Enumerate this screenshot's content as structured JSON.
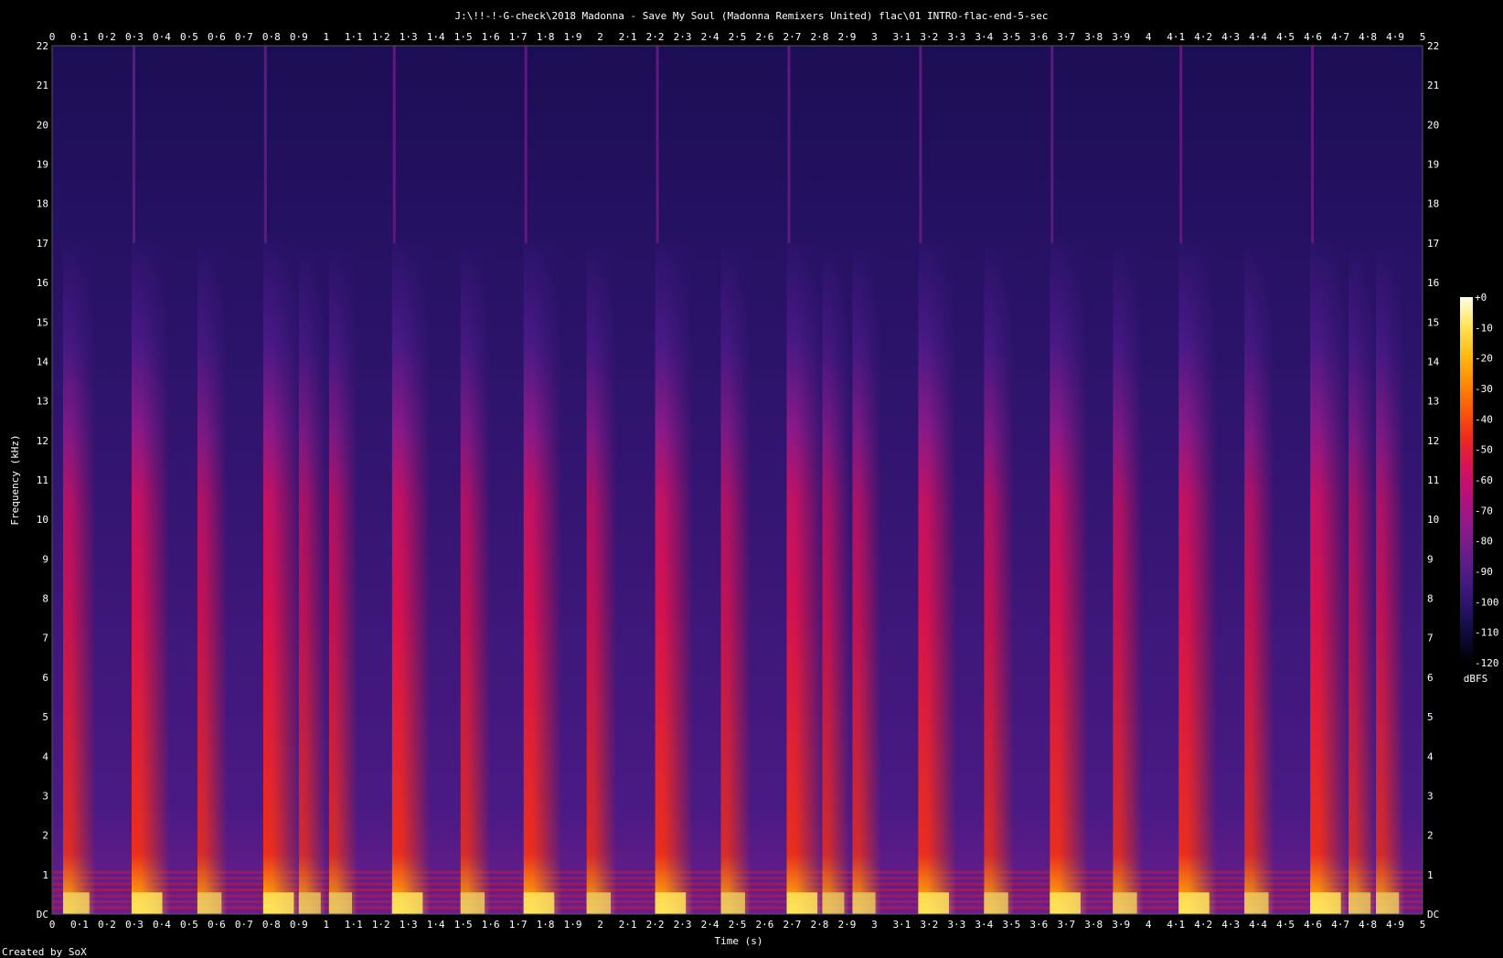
{
  "footer": {
    "credit": "Created by SoX"
  },
  "chart_data": {
    "type": "heatmap",
    "title": "J:\\!!-!-G-check\\2018 Madonna - Save My Soul (Madonna Remixers United) flac\\01 INTRO-flac-end-5-sec",
    "xlabel": "Time (s)",
    "ylabel": "Frequency (kHz)",
    "xlim": [
      0,
      5
    ],
    "ylim": [
      0,
      22
    ],
    "x_ticks": [
      "0",
      "0·1",
      "0·2",
      "0·3",
      "0·4",
      "0·5",
      "0·6",
      "0·7",
      "0·8",
      "0·9",
      "1",
      "1·1",
      "1·2",
      "1·3",
      "1·4",
      "1·5",
      "1·6",
      "1·7",
      "1·8",
      "1·9",
      "2",
      "2·1",
      "2·2",
      "2·3",
      "2·4",
      "2·5",
      "2·6",
      "2·7",
      "2·8",
      "2·9",
      "3",
      "3·1",
      "3·2",
      "3·3",
      "3·4",
      "3·5",
      "3·6",
      "3·7",
      "3·8",
      "3·9",
      "4",
      "4·1",
      "4·2",
      "4·3",
      "4·4",
      "4·5",
      "4·6",
      "4·7",
      "4·8",
      "4·9",
      "5"
    ],
    "y_ticks": [
      "DC",
      "1",
      "2",
      "3",
      "4",
      "5",
      "6",
      "7",
      "8",
      "9",
      "10",
      "11",
      "12",
      "13",
      "14",
      "15",
      "16",
      "17",
      "18",
      "19",
      "20",
      "21",
      "22"
    ],
    "colorbar": {
      "label": "dBFS",
      "range": [
        -120,
        0
      ],
      "ticks": [
        "+0",
        "-10",
        "-20",
        "-30",
        "-40",
        "-50",
        "-60",
        "-70",
        "-80",
        "-90",
        "-100",
        "-110",
        "-120"
      ],
      "colors": [
        "#000000",
        "#0c0b3a",
        "#2a1369",
        "#4b1a86",
        "#6e1d8a",
        "#93198a",
        "#b8107a",
        "#d8125a",
        "#ee2a1e",
        "#fb5a08",
        "#ff8c05",
        "#ffbd14",
        "#ffe55a",
        "#ffffe8"
      ]
    },
    "grid": false,
    "transients": [
      {
        "time": 0.04,
        "strength": 0.8,
        "top_khz": 17.0
      },
      {
        "time": 0.29,
        "strength": 1.0,
        "top_khz": 22.0
      },
      {
        "time": 0.53,
        "strength": 0.7,
        "top_khz": 17.0
      },
      {
        "time": 0.77,
        "strength": 1.0,
        "top_khz": 22.0
      },
      {
        "time": 0.9,
        "strength": 0.6,
        "top_khz": 17.0
      },
      {
        "time": 1.01,
        "strength": 0.65,
        "top_khz": 17.0
      },
      {
        "time": 1.24,
        "strength": 1.0,
        "top_khz": 22.0
      },
      {
        "time": 1.49,
        "strength": 0.7,
        "top_khz": 17.0
      },
      {
        "time": 1.72,
        "strength": 1.0,
        "top_khz": 22.0
      },
      {
        "time": 1.95,
        "strength": 0.7,
        "top_khz": 17.0
      },
      {
        "time": 2.2,
        "strength": 1.0,
        "top_khz": 22.0
      },
      {
        "time": 2.44,
        "strength": 0.7,
        "top_khz": 17.0
      },
      {
        "time": 2.68,
        "strength": 1.0,
        "top_khz": 22.0
      },
      {
        "time": 2.81,
        "strength": 0.6,
        "top_khz": 17.0
      },
      {
        "time": 2.92,
        "strength": 0.65,
        "top_khz": 17.0
      },
      {
        "time": 3.16,
        "strength": 1.0,
        "top_khz": 22.0
      },
      {
        "time": 3.4,
        "strength": 0.7,
        "top_khz": 17.0
      },
      {
        "time": 3.64,
        "strength": 1.0,
        "top_khz": 22.0
      },
      {
        "time": 3.87,
        "strength": 0.7,
        "top_khz": 17.0
      },
      {
        "time": 4.11,
        "strength": 1.0,
        "top_khz": 22.0
      },
      {
        "time": 4.35,
        "strength": 0.7,
        "top_khz": 17.0
      },
      {
        "time": 4.59,
        "strength": 1.0,
        "top_khz": 22.0
      },
      {
        "time": 4.73,
        "strength": 0.6,
        "top_khz": 17.0
      },
      {
        "time": 4.83,
        "strength": 0.65,
        "top_khz": 17.0
      }
    ],
    "lowband_harmonics_khz": [
      0.15,
      0.3,
      0.45,
      0.6,
      0.75,
      0.9,
      1.05
    ],
    "noise_floor_dbfs": -95,
    "cutoff_khz": 16.5
  }
}
